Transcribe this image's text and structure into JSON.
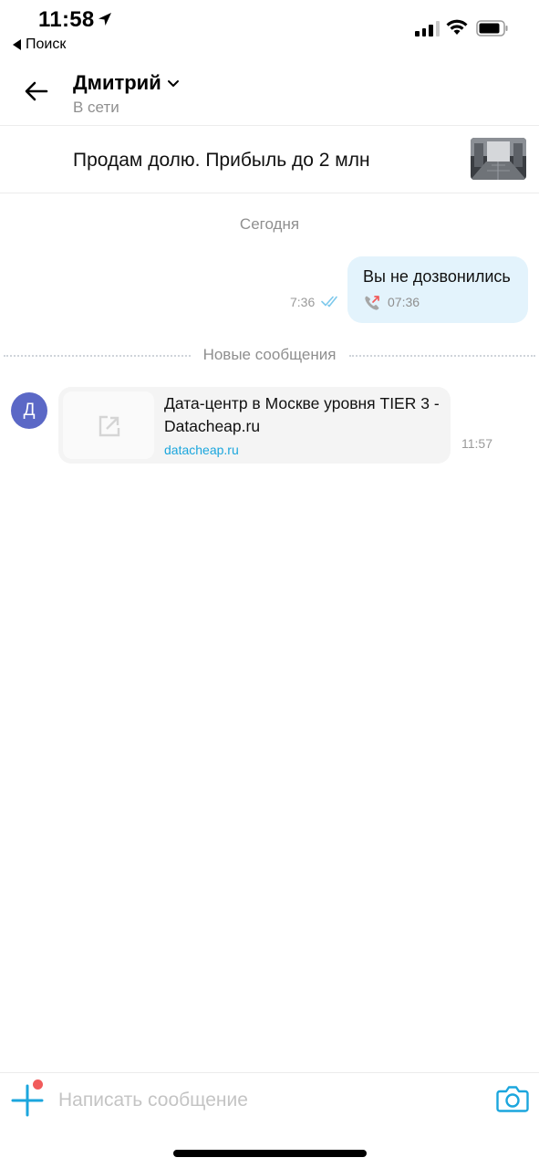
{
  "status_bar": {
    "time": "11:58",
    "back_app_label": "Поиск"
  },
  "header": {
    "contact_name": "Дмитрий",
    "contact_status": "В сети"
  },
  "listing": {
    "title": "Продам долю. Прибыль до 2 млн"
  },
  "chat": {
    "date_separator": "Сегодня",
    "outgoing": {
      "text": "Вы не дозвонились",
      "call_time": "07:36",
      "sent_time": "7:36",
      "status": "read"
    },
    "new_messages_label": "Новые сообщения",
    "incoming": {
      "avatar_letter": "Д",
      "link_title": "Дата-центр в Москве уровня TIER 3 - Datacheap.ru",
      "link_domain": "datacheap.ru",
      "time": "11:57"
    }
  },
  "composer": {
    "placeholder": "Написать сообщение"
  },
  "colors": {
    "accent": "#1ba6dd",
    "outgoing_bubble": "#e3f3fc",
    "avatar": "#5b68c6",
    "missed_call": "#f15b5b"
  },
  "icons": [
    "location-arrow-icon",
    "cellular-signal-icon",
    "wifi-icon",
    "battery-icon",
    "back-arrow-icon",
    "chevron-down-icon",
    "double-check-icon",
    "missed-call-icon",
    "external-link-icon",
    "plus-icon",
    "camera-icon"
  ]
}
